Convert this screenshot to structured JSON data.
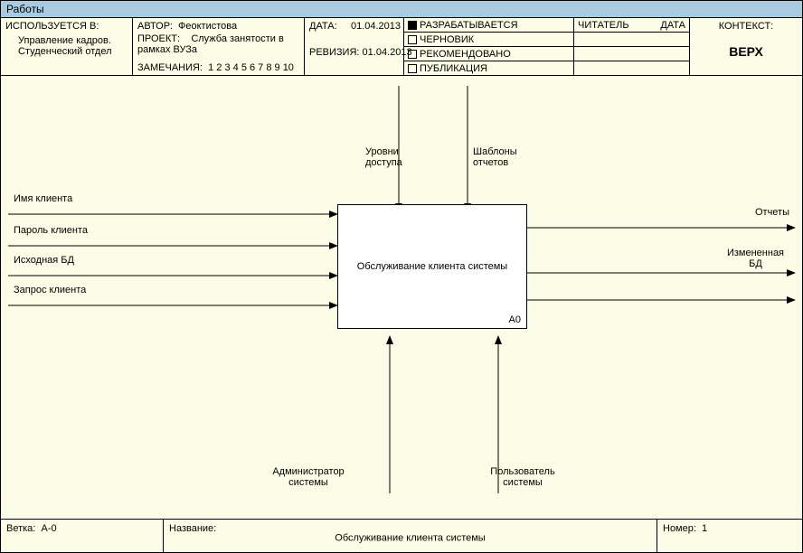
{
  "title": "Работы",
  "header": {
    "used_in_label": "ИСПОЛЬЗУЕТСЯ В:",
    "used_in_value": "Управление кадров. Студенческий отдел",
    "author_label": "АВТОР:",
    "author_value": "Феоктистова",
    "project_label": "ПРОЕКТ:",
    "project_value": "Служба занятости в рамках ВУЗа",
    "remarks_label": "ЗАМЕЧАНИЯ:",
    "remarks_value": "1  2  3  4  5  6  7  8  9  10",
    "date_label": "ДАТА:",
    "date_value": "01.04.2013",
    "revision_label": "РЕВИЗИЯ:",
    "revision_value": "01.04.2013",
    "status": {
      "in_dev": "РАЗРАБАТЫВАЕТСЯ",
      "draft": "ЧЕРНОВИК",
      "recommended": "РЕКОМЕНДОВАНО",
      "publication": "ПУБЛИКАЦИЯ"
    },
    "reader_label": "ЧИТАТЕЛЬ",
    "date2_label": "ДАТА",
    "context_label": "КОНТЕКСТ:",
    "context_value": "ВЕРХ"
  },
  "diagram": {
    "process_title": "Обслуживание клиента системы",
    "process_id": "А0",
    "inputs": [
      "Имя клиента",
      "Пароль клиента",
      "Исходная БД",
      "Запрос клиента"
    ],
    "controls": [
      "Уровни доступа",
      "Шаблоны отчетов"
    ],
    "outputs": [
      "Отчеты",
      "Измененная БД"
    ],
    "mechanisms": [
      "Администратор системы",
      "Пользователь системы"
    ]
  },
  "footer": {
    "branch_label": "Ветка:",
    "branch_value": "А-0",
    "name_label": "Название:",
    "name_value": "Обслуживание клиента системы",
    "number_label": "Номер:",
    "number_value": "1"
  }
}
